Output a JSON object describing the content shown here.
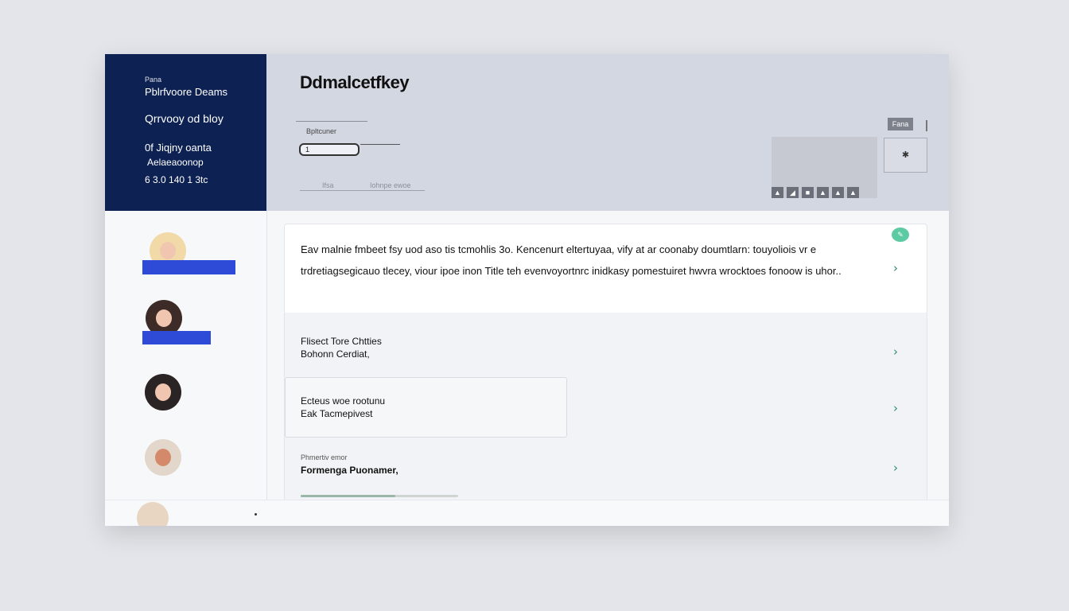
{
  "sidebar_profile": {
    "tag": "Pana",
    "name": "Pblrfvoore Deams",
    "subtitle": "Qrrvooy od bloy",
    "line1": "0f Jiqjny oanta",
    "line2": "Aelaeaoonop",
    "line3": "6 3.0 140 1 3tc"
  },
  "header": {
    "title": "Ddmalcetfkey",
    "small_label": "Bpltcuner",
    "input_value": "1",
    "footer_link_a": "Ifsa",
    "footer_link_b": "Iohnpe ewoe",
    "top_button": "Fana",
    "side_button": "✱",
    "thumb_icons": [
      "▲",
      "◢",
      "■",
      "▲",
      "▲",
      "▲"
    ]
  },
  "main": {
    "description": "Eav malnie fmbeet fsy uod aso tis tcmohlis 3o. Kencenurt eltertuyaa, vify at ar coonaby doumtlarn: touyoliois vr e trdretiagsegicauo tlecey, viour ipoe inon Title teh evenvoyortnrc inidkasy pomestuiret hwvra wrocktoes fonoow is uhor..",
    "rows": [
      {
        "title": "Flisect Tore Chtties",
        "subtitle": "Bohonn Cerdiat,"
      },
      {
        "title": "Ecteus woe rootunu",
        "subtitle": "Eak Tacmepivest"
      },
      {
        "title": "Formenga Puonamer,",
        "subtitle": "Phmertiv emor"
      }
    ],
    "chat_icon": "chat-bubble-icon",
    "chevron_glyph": "›",
    "progress": 0.6
  },
  "colors": {
    "navy": "#0d2253",
    "accent_blue": "#2d4bd7",
    "mint": "#5ccba3"
  }
}
